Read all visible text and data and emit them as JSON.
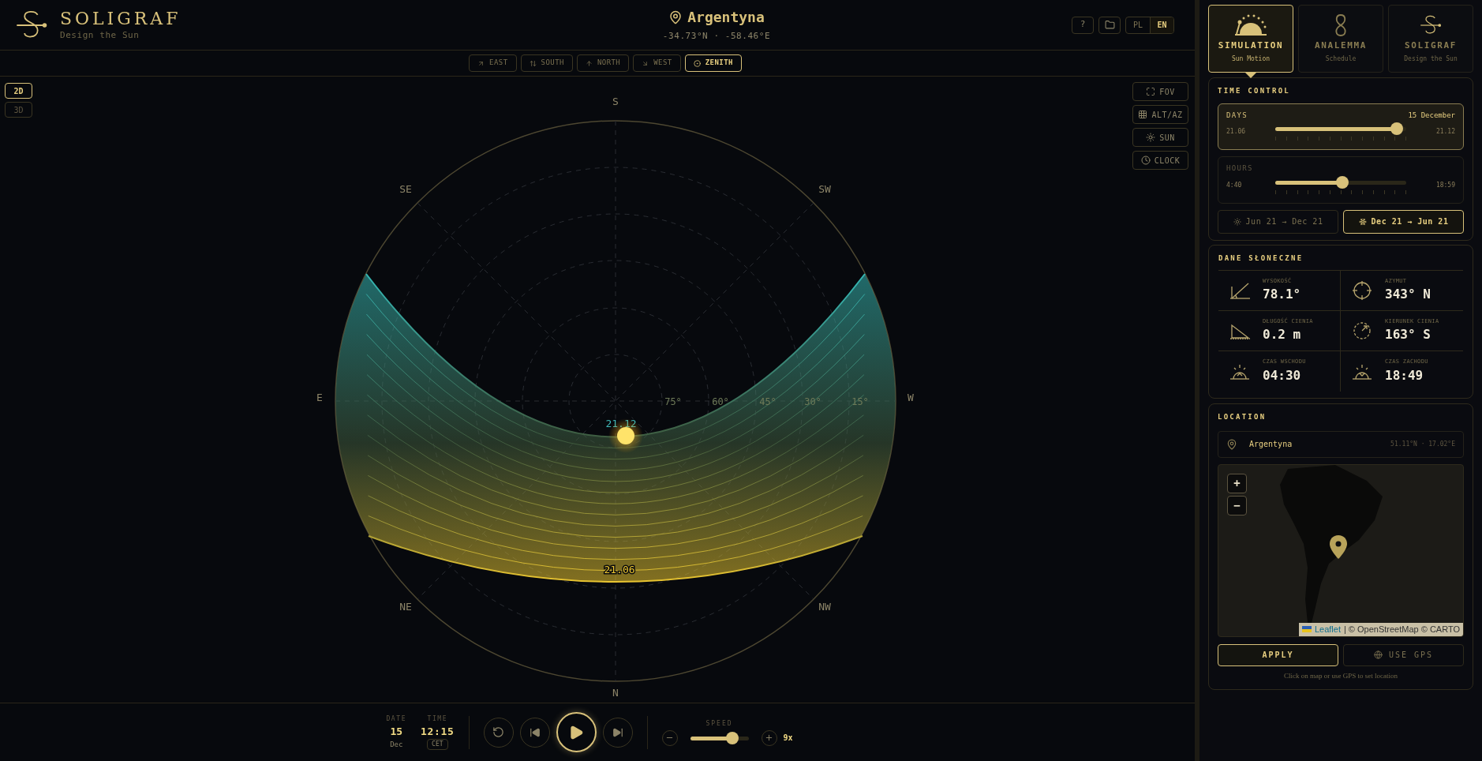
{
  "header": {
    "logo_title": "SOLIGRAF",
    "logo_subtitle": "Design the Sun",
    "location": "Argentyna",
    "coordinates": "-34.73°N · -58.46°E",
    "help": "?",
    "languages": [
      {
        "label": "PL",
        "selected": false
      },
      {
        "label": "EN",
        "selected": true
      }
    ]
  },
  "view_buttons": [
    {
      "label": "EAST",
      "kind": "east",
      "selected": false
    },
    {
      "label": "SOUTH",
      "kind": "south",
      "selected": false
    },
    {
      "label": "NORTH",
      "kind": "north",
      "selected": false
    },
    {
      "label": "WEST",
      "kind": "west",
      "selected": false
    },
    {
      "label": "ZENITH",
      "kind": "zenith",
      "selected": true
    }
  ],
  "dimension_toggle": [
    {
      "label": "2D",
      "selected": true
    },
    {
      "label": "3D",
      "selected": false
    }
  ],
  "overlay_buttons": [
    {
      "label": "FOV",
      "kind": "fov"
    },
    {
      "label": "ALT/AZ",
      "kind": "grid"
    },
    {
      "label": "SUN",
      "kind": "sun"
    },
    {
      "label": "CLOCK",
      "kind": "clock"
    }
  ],
  "sky_chart": {
    "compass": [
      "S",
      "SE",
      "SW",
      "E",
      "W",
      "NE",
      "NW",
      "N"
    ],
    "altitudes": [
      "75°",
      "60°",
      "45°",
      "30°",
      "15°"
    ],
    "path_labels": [
      {
        "label": "21.12",
        "kind": "winter"
      },
      {
        "label": "21.06",
        "kind": "summer"
      }
    ]
  },
  "playback": {
    "date_label": "DATE",
    "day": "15",
    "month": "Dec",
    "time_label": "TIME",
    "time": "12:15",
    "timezone": "CET",
    "speed_label": "SPEED",
    "speed": {
      "level": 0.72
    },
    "speed_value": "9x"
  },
  "modes": [
    {
      "title": "SIMULATION",
      "subtitle": "Sun Motion",
      "kind": "simulation",
      "selected": true
    },
    {
      "title": "ANALEMMA",
      "subtitle": "Schedule",
      "kind": "analemma",
      "selected": false
    },
    {
      "title": "SOLIGRAF",
      "subtitle": "Design the Sun",
      "kind": "soligraf",
      "selected": false
    }
  ],
  "time_control": {
    "title": "TIME CONTROL",
    "sliders": [
      {
        "label": "DAYS",
        "value": "15 December",
        "min": "21.06",
        "max": "21.12",
        "level": 0.93,
        "selected": true
      },
      {
        "label": "HOURS",
        "min": "4:40",
        "max": "18:59",
        "level": 0.51,
        "selected": false
      }
    ],
    "directions": [
      {
        "label": "Jun 21 → Dec 21",
        "kind": "sun",
        "selected": false
      },
      {
        "label": "Dec 21 → Jun 21",
        "kind": "snow",
        "selected": true
      }
    ]
  },
  "solar_data": {
    "title": "DANE SŁONECZNE",
    "items": [
      {
        "label": "WYSOKOŚĆ",
        "value": "78.1°",
        "kind": "altitude"
      },
      {
        "label": "AZYMUT",
        "value": "343° N",
        "kind": "azimuth"
      },
      {
        "label": "DŁUGOŚĆ CIENIA",
        "value": "0.2 m",
        "kind": "shadow"
      },
      {
        "label": "KIERUNEK CIENIA",
        "value": "163° S",
        "kind": "direction"
      },
      {
        "label": "CZAS WSCHODU",
        "value": "04:30",
        "kind": "sunrise"
      },
      {
        "label": "CZAS ZACHODU",
        "value": "18:49",
        "kind": "sunset"
      }
    ]
  },
  "location": {
    "title": "LOCATION",
    "name": "Argentyna",
    "coordinates": "51.11°N · 17.02°E",
    "zoom_in": "+",
    "zoom_out": "−",
    "attribution_link": "Leaflet",
    "attribution": "| © OpenStreetMap © CARTO",
    "apply": "APPLY",
    "gps": "USE GPS",
    "hint": "Click on map or use GPS to set location"
  }
}
